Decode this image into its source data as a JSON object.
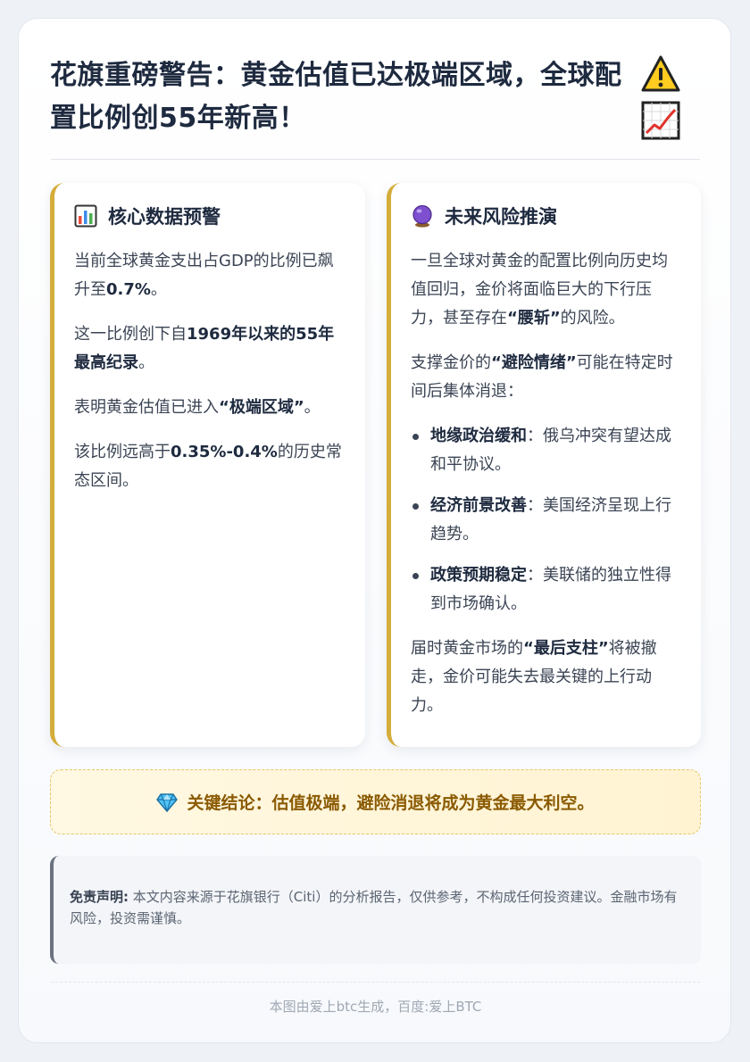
{
  "header": {
    "title": "花旗重磅警告：黄金估值已达极端区域，全球配置比例创55年新高！",
    "icons": [
      "warning-icon",
      "chart-increasing-icon"
    ]
  },
  "left_panel": {
    "icon": "bar-chart-icon",
    "title": "核心数据预警",
    "paragraphs": [
      {
        "pre": "当前全球黄金支出占GDP的比例已飙升至",
        "bold": "0.7%",
        "post": "。"
      },
      {
        "pre": "这一比例创下自",
        "bold": "1969年以来的55年最高纪录",
        "post": "。"
      },
      {
        "pre": "表明黄金估值已进入",
        "bold": "“极端区域”",
        "post": "。"
      },
      {
        "pre": "该比例远高于",
        "bold": "0.35%-0.4%",
        "post": "的历史常态区间。"
      }
    ]
  },
  "right_panel": {
    "icon": "crystal-ball-icon",
    "title": "未来风险推演",
    "p1": {
      "pre": "一旦全球对黄金的配置比例向历史均值回归，金价将面临巨大的下行压力，甚至存在",
      "bold": "“腰斩”",
      "post": "的风险。"
    },
    "p2": {
      "pre": "支撑金价的",
      "bold": "“避险情绪”",
      "post": "可能在特定时间后集体消退："
    },
    "bullets": [
      {
        "bold": "地缘政治缓和",
        "text": "：俄乌冲突有望达成和平协议。"
      },
      {
        "bold": "经济前景改善",
        "text": "：美国经济呈现上行趋势。"
      },
      {
        "bold": "政策预期稳定",
        "text": "：美联储的独立性得到市场确认。"
      }
    ],
    "p3": {
      "pre": "届时黄金市场的",
      "bold": "“最后支柱”",
      "post": "将被撤走，金价可能失去最关键的上行动力。"
    }
  },
  "conclusion": {
    "icon": "gem-icon",
    "text": "关键结论：估值极端，避险消退将成为黄金最大利空。"
  },
  "disclaimer": {
    "label": "免责声明:",
    "text": " 本文内容来源于花旗银行（Citi）的分析报告，仅供参考，不构成任何投资建议。金融市场有风险，投资需谨慎。"
  },
  "footer": "本图由爱上btc生成，百度:爱上BTC",
  "colors": {
    "accent_gold": "#d4ad3a",
    "title_navy": "#1e2a3f",
    "conclusion_text": "#8a5a00"
  }
}
